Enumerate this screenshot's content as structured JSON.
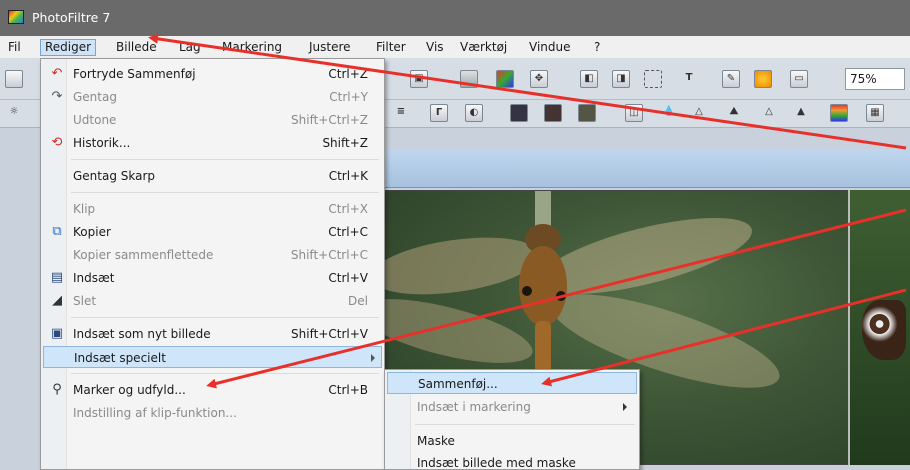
{
  "window": {
    "title": "PhotoFiltre 7"
  },
  "menubar": {
    "items": [
      "Fil",
      "Rediger",
      "Billede",
      "Lag",
      "Markering",
      "Justere",
      "Filter",
      "Vis",
      "Værktøj",
      "Vindue",
      "?"
    ]
  },
  "toolbar": {
    "zoom": "75%"
  },
  "edit_menu": {
    "items": [
      {
        "label": "Fortryde Sammenføj",
        "shortcut": "Ctrl+Z",
        "icon": "undo-icon",
        "enabled": true
      },
      {
        "label": "Gentag",
        "shortcut": "Ctrl+Y",
        "icon": "redo-icon",
        "enabled": false
      },
      {
        "label": "Udtone",
        "shortcut": "Shift+Ctrl+Z",
        "icon": "",
        "enabled": false
      },
      {
        "label": "Historik...",
        "shortcut": "Shift+Z",
        "icon": "history-icon",
        "enabled": true
      },
      {
        "label": "Gentag Skarp",
        "shortcut": "Ctrl+K",
        "icon": "",
        "enabled": true
      },
      {
        "label": "Klip",
        "shortcut": "Ctrl+X",
        "icon": "",
        "enabled": false
      },
      {
        "label": "Kopier",
        "shortcut": "Ctrl+C",
        "icon": "copy-icon",
        "enabled": true
      },
      {
        "label": "Kopier sammenflettede",
        "shortcut": "Shift+Ctrl+C",
        "icon": "",
        "enabled": false
      },
      {
        "label": "Indsæt",
        "shortcut": "Ctrl+V",
        "icon": "paste-icon",
        "enabled": true
      },
      {
        "label": "Slet",
        "shortcut": "Del",
        "icon": "eraser-icon",
        "enabled": false
      },
      {
        "label": "Indsæt som nyt billede",
        "shortcut": "Shift+Ctrl+V",
        "icon": "paste-new-icon",
        "enabled": true
      },
      {
        "label": "Indsæt specielt",
        "shortcut": "",
        "icon": "",
        "enabled": true,
        "highlighted": true,
        "submenu": true
      },
      {
        "label": "Marker og udfyld...",
        "shortcut": "Ctrl+B",
        "icon": "fill-icon",
        "enabled": true
      },
      {
        "label": "Indstilling af klip-funktion...",
        "shortcut": "",
        "icon": "",
        "enabled": false
      }
    ]
  },
  "paste_special_menu": {
    "items": [
      {
        "label": "Sammenføj...",
        "enabled": true,
        "highlighted": true
      },
      {
        "label": "Indsæt i markering",
        "enabled": false,
        "submenu": true
      },
      {
        "label": "Maske",
        "enabled": true
      },
      {
        "label": "Indsæt billede med maske",
        "enabled": true
      }
    ]
  },
  "annotation_color": "#e8302b"
}
